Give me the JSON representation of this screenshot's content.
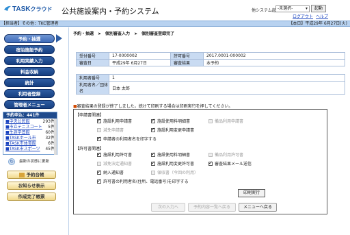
{
  "header": {
    "logo_main": "TASK",
    "logo_sub": "クラウド",
    "title": "公共施設案内・予約システム",
    "other_system_label": "他システム起動：",
    "system_select_value": "-未選択-",
    "start_button": "起動",
    "logout": "ログアウト",
    "help": "ヘルプ"
  },
  "infobar": {
    "left": "【担当者】その他：TKC管理者",
    "right": "【本日】平成29年 6月27日(火)"
  },
  "sidebar": {
    "nav": [
      {
        "label": "予約・抽選"
      },
      {
        "label": "宿泊施設予約"
      },
      {
        "label": "利用実績入力"
      },
      {
        "label": "料金収納"
      },
      {
        "label": "統計"
      },
      {
        "label": "利用者登録"
      },
      {
        "label": "管理者メニュー"
      }
    ],
    "queue_title": "予約申込：441件",
    "queue": [
      {
        "name": "■中央公民館",
        "count": "293件"
      },
      {
        "name": "■市立テニスコート",
        "count": "5件"
      },
      {
        "name": "■生涯学習館",
        "count": "60件"
      },
      {
        "name": "■TASKホール市",
        "count": "32件"
      },
      {
        "name": "■TASK市体育館",
        "count": "6件"
      },
      {
        "name": "■TASK市スポーツ",
        "count": "45件"
      }
    ],
    "refresh_label": "最新の状態に更新",
    "gold_buttons": [
      {
        "label": "予約台帳"
      },
      {
        "label": "お知らせ表示"
      },
      {
        "label": "作成完了帳票"
      }
    ]
  },
  "main": {
    "breadcrumb": [
      "予約・抽選",
      "個別審査入力",
      "個別審査登録完了"
    ],
    "details": {
      "accept_no_label": "受付番号",
      "accept_no": "17-0000002",
      "permit_no_label": "許可番号",
      "permit_no": "2017.0001-000002",
      "review_date_label": "審査日",
      "review_date": "平成29年 6月27日",
      "review_result_label": "審査結果",
      "review_result": "本予約",
      "user_no_label": "利用者番号",
      "user_no": "1",
      "user_name_label": "利用者名／団体名",
      "user_name": "日本 太郎"
    },
    "notice": "審査結果の登録が終了しました。続けて印刷する場合は印刷実行を押してください。",
    "notice_marker": "■",
    "application_section": "【申請書関連】",
    "application_items": [
      {
        "label": "施設利用申請書",
        "checked": true,
        "disabled": false
      },
      {
        "label": "施設使用料明細書",
        "checked": true,
        "disabled": false
      },
      {
        "label": "備品利用申請書",
        "checked": false,
        "disabled": true
      },
      {
        "label": "減免申請書",
        "checked": false,
        "disabled": true
      },
      {
        "label": "施設利用変更申請書",
        "checked": true,
        "disabled": false
      },
      {
        "label": "申請者の利用者名を印字する",
        "checked": true,
        "disabled": false
      }
    ],
    "permit_section": "【許可書関連】",
    "permit_items": [
      {
        "label": "施設利用許可書",
        "checked": true,
        "disabled": false
      },
      {
        "label": "施設使用料明細書",
        "checked": true,
        "disabled": false
      },
      {
        "label": "備品利用許可書",
        "checked": false,
        "disabled": true
      },
      {
        "label": "減免決定通知書",
        "checked": false,
        "disabled": true
      },
      {
        "label": "施設利用変更許可書",
        "checked": true,
        "disabled": false
      },
      {
        "label": "審査結果メール送信",
        "checked": true,
        "disabled": false
      },
      {
        "label": "納入通知書",
        "checked": true,
        "disabled": false
      },
      {
        "label": "領収書（今回の利用）",
        "checked": false,
        "disabled": true
      },
      {
        "label": "許可書の利用者名(住所、電話番号)を印字する",
        "checked": true,
        "disabled": false
      }
    ],
    "print_button": "印刷実行",
    "bottom_buttons": [
      {
        "label": "次の入力へ",
        "disabled": true
      },
      {
        "label": "予約内容一覧へ戻る",
        "disabled": true
      },
      {
        "label": "メニューへ戻る",
        "disabled": false
      }
    ]
  },
  "colors": {
    "nav_blue": "#1f4a8c",
    "infobar": "#b8d2f0",
    "label_cell": "#c9dbf2",
    "gold": "#f0d88c"
  }
}
